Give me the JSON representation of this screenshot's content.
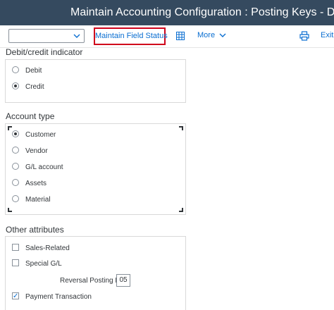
{
  "header": {
    "title": "Maintain Accounting Configuration : Posting Keys - Detail S..."
  },
  "toolbar": {
    "select_value": "",
    "maintain_field_status_label": "Maintain Field Status",
    "more_label": "More",
    "exit_label": "Exit"
  },
  "debit_credit": {
    "title": "Debit/credit indicator",
    "options": [
      {
        "label": "Debit",
        "selected": false
      },
      {
        "label": "Credit",
        "selected": true
      }
    ]
  },
  "account_type": {
    "title": "Account type",
    "options": [
      {
        "label": "Customer",
        "selected": true
      },
      {
        "label": "Vendor",
        "selected": false
      },
      {
        "label": "G/L account",
        "selected": false
      },
      {
        "label": "Assets",
        "selected": false
      },
      {
        "label": "Material",
        "selected": false
      }
    ]
  },
  "other_attributes": {
    "title": "Other attributes",
    "sales_related": {
      "label": "Sales-Related",
      "checked": false
    },
    "special_gl": {
      "label": "Special G/L",
      "checked": false
    },
    "reversal_posting_key": {
      "label": "Reversal Posting Key:",
      "value": "05"
    },
    "payment_transaction": {
      "label": "Payment Transaction",
      "checked": true
    }
  },
  "colors": {
    "shell": "#354a5f",
    "accent": "#0a6ed1",
    "highlight": "#d0021b"
  }
}
